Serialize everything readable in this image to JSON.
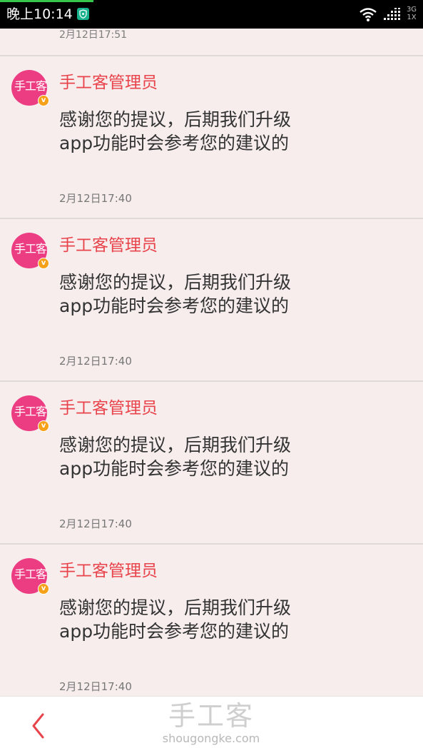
{
  "status_bar": {
    "time": "晚上10:14",
    "network_type": "3G",
    "network_sub": "1X",
    "icons": [
      "shield-icon",
      "wifi-icon",
      "signal-icon"
    ]
  },
  "top_partial": {
    "time": "2月12日17:51"
  },
  "messages": [
    {
      "avatar_text": "手工客",
      "badge": "v",
      "sender": "手工客管理员",
      "body": "感谢您的提议，后期我们升级app功能时会参考您的建议的",
      "time": "2月12日17:40"
    },
    {
      "avatar_text": "手工客",
      "badge": "v",
      "sender": "手工客管理员",
      "body": "感谢您的提议，后期我们升级app功能时会参考您的建议的",
      "time": "2月12日17:40"
    },
    {
      "avatar_text": "手工客",
      "badge": "v",
      "sender": "手工客管理员",
      "body": "感谢您的提议，后期我们升级app功能时会参考您的建议的",
      "time": "2月12日17:40"
    },
    {
      "avatar_text": "手工客",
      "badge": "v",
      "sender": "手工客管理员",
      "body": "感谢您的提议，后期我们升级app功能时会参考您的建议的",
      "time": "2月12日17:40"
    }
  ],
  "bottom_bar": {
    "back_icon": "chevron-left-icon",
    "brand_name": "手工客",
    "brand_url": "shougongke.com"
  },
  "colors": {
    "accent": "#e8444c",
    "avatar_bg": "#ec3d83",
    "badge_bg": "#f5a21a",
    "page_bg": "#f7eded"
  }
}
